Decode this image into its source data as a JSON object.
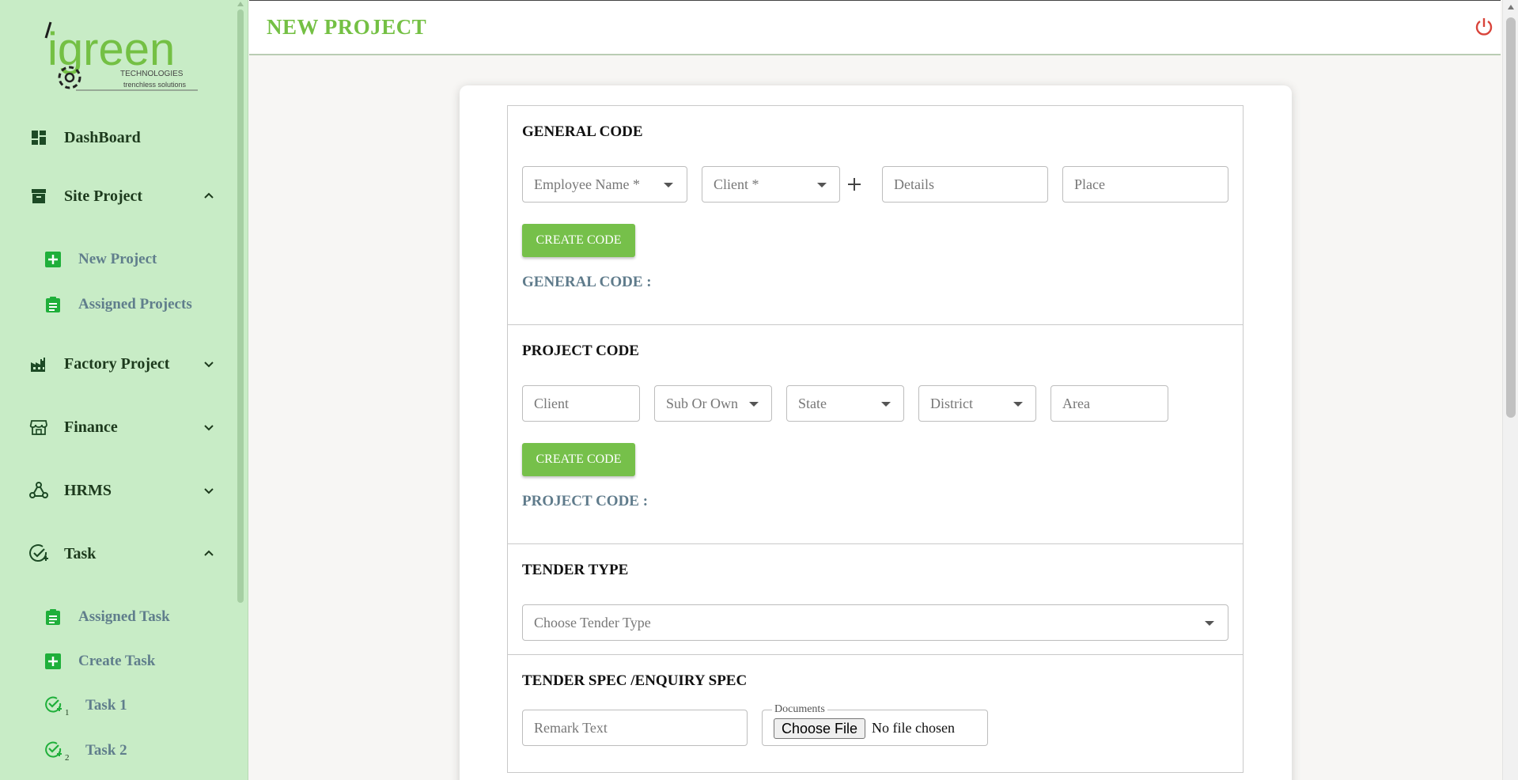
{
  "brand": {
    "logo_text": "igreen",
    "logo_sub1": "TECHNOLOGIES",
    "logo_sub2": "trenchless solutions"
  },
  "header": {
    "title": "NEW PROJECT",
    "power_icon": "power-icon"
  },
  "sidebar": {
    "items": [
      {
        "label": "DashBoard",
        "icon": "dashboard-icon"
      },
      {
        "label": "Site Project",
        "icon": "archive-icon",
        "expanded": true
      },
      {
        "label": "New Project",
        "icon": "plus-square-icon"
      },
      {
        "label": "Assigned Projects",
        "icon": "clipboard-icon"
      },
      {
        "label": "Factory Project",
        "icon": "factory-icon"
      },
      {
        "label": "Finance",
        "icon": "store-icon"
      },
      {
        "label": "HRMS",
        "icon": "people-network-icon"
      },
      {
        "label": "Task",
        "icon": "task-check-icon",
        "expanded": true
      },
      {
        "label": "Assigned Task",
        "icon": "clipboard-icon"
      },
      {
        "label": "Create Task",
        "icon": "plus-square-icon"
      },
      {
        "label": "Task 1",
        "icon": "task-check-icon",
        "sub": "1"
      },
      {
        "label": "Task 2",
        "icon": "task-check-icon",
        "sub": "2"
      }
    ]
  },
  "general": {
    "title": "GENERAL CODE",
    "employee_placeholder": "Employee Name *",
    "client_placeholder": "Client *",
    "details_placeholder": "Details",
    "place_placeholder": "Place",
    "button": "CREATE CODE",
    "code_label": "GENERAL CODE :"
  },
  "project": {
    "title": "PROJECT CODE",
    "client_placeholder": "Client",
    "sub_or_own_placeholder": "Sub Or Own",
    "state_placeholder": "State",
    "district_placeholder": "District",
    "area_placeholder": "Area",
    "button": "CREATE CODE",
    "code_label": "PROJECT CODE :"
  },
  "tender": {
    "title": "TENDER TYPE",
    "placeholder": "Choose Tender Type"
  },
  "spec": {
    "title": "TENDER SPEC /ENQUIRY SPEC",
    "remark_placeholder": "Remark Text",
    "documents_legend": "Documents",
    "choose_file": "Choose File",
    "no_file": "No file chosen"
  },
  "colors": {
    "sidebar_bg": "#c8ecc6",
    "accent_green": "#76c04a",
    "title_green": "#74c044",
    "power_red": "#d9443b"
  }
}
